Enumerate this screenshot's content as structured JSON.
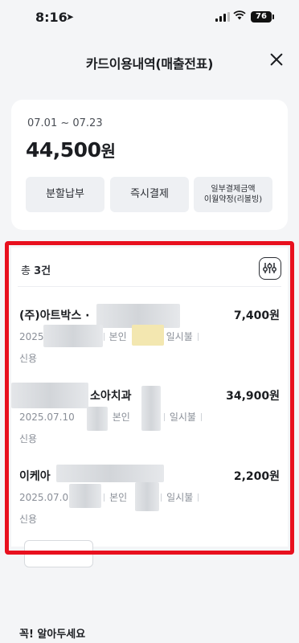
{
  "status_bar": {
    "time": "8:16",
    "battery": "76"
  },
  "header": {
    "title": "카드이용내역(매출전표)"
  },
  "summary": {
    "period": "07.01 ~ 07.23",
    "total": "44,500",
    "total_unit": "원",
    "buttons": [
      {
        "label": "분할납부"
      },
      {
        "label": "즉시결제"
      },
      {
        "label_line1": "일부결제금액",
        "label_line2": "이월약정(리볼빙)"
      }
    ]
  },
  "list": {
    "count_prefix": "총 ",
    "count_value": "3건",
    "transactions": [
      {
        "merchant": "(주)아트박스 ·",
        "amount": "7,400원",
        "date": "2025",
        "owner": "본인",
        "installment": "일시불",
        "type": "신용"
      },
      {
        "merchant": "소아치과",
        "amount": "34,900원",
        "date": "2025.07.10",
        "owner": "본인",
        "installment": "일시불",
        "type": "신용"
      },
      {
        "merchant": "이케아",
        "amount": "2,200원",
        "date": "2025.07.0",
        "owner": "본인",
        "installment": "일시불",
        "type": "신용"
      }
    ]
  },
  "footer": {
    "section_title": "꼭! 알아두세요"
  },
  "colors": {
    "highlight_frame": "#e8101e",
    "background": "#f4f5f7"
  },
  "icons": [
    "location-arrow-icon",
    "signal-icon",
    "wifi-icon",
    "battery-icon",
    "close-icon",
    "filter-icon"
  ]
}
